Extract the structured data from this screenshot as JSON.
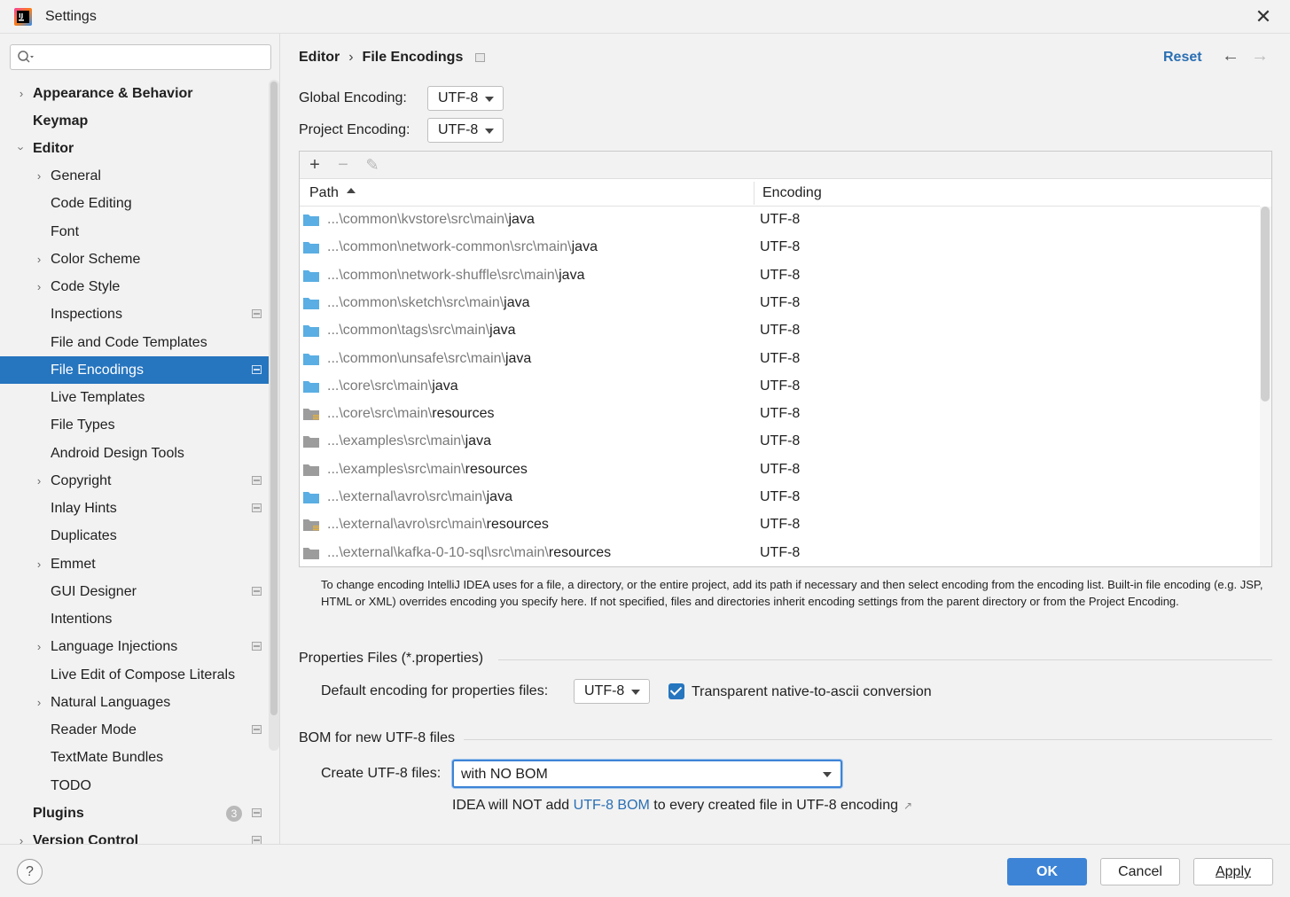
{
  "window": {
    "title": "Settings"
  },
  "search": {
    "placeholder": ""
  },
  "sidebar": {
    "items": [
      {
        "label": "Appearance & Behavior"
      },
      {
        "label": "Keymap"
      },
      {
        "label": "Editor"
      },
      {
        "label": "General"
      },
      {
        "label": "Code Editing"
      },
      {
        "label": "Font"
      },
      {
        "label": "Color Scheme"
      },
      {
        "label": "Code Style"
      },
      {
        "label": "Inspections"
      },
      {
        "label": "File and Code Templates"
      },
      {
        "label": "File Encodings"
      },
      {
        "label": "Live Templates"
      },
      {
        "label": "File Types"
      },
      {
        "label": "Android Design Tools"
      },
      {
        "label": "Copyright"
      },
      {
        "label": "Inlay Hints"
      },
      {
        "label": "Duplicates"
      },
      {
        "label": "Emmet"
      },
      {
        "label": "GUI Designer"
      },
      {
        "label": "Intentions"
      },
      {
        "label": "Language Injections"
      },
      {
        "label": "Live Edit of Compose Literals"
      },
      {
        "label": "Natural Languages"
      },
      {
        "label": "Reader Mode"
      },
      {
        "label": "TextMate Bundles"
      },
      {
        "label": "TODO"
      },
      {
        "label": "Plugins",
        "badge": "3"
      },
      {
        "label": "Version Control"
      }
    ]
  },
  "header": {
    "breadcrumb_parent": "Editor",
    "breadcrumb_sep": "›",
    "breadcrumb_current": "File Encodings",
    "reset_label": "Reset",
    "back_icon": "←",
    "forward_icon": "→"
  },
  "encoding": {
    "global_label": "Global Encoding:",
    "global_value": "UTF-8",
    "project_label": "Project Encoding:",
    "project_value": "UTF-8"
  },
  "table": {
    "toolbar": {
      "add": "+",
      "remove": "−",
      "edit": "✎"
    },
    "columns": {
      "path": "Path",
      "encoding": "Encoding"
    },
    "rows": [
      {
        "dim": "...\\common\\kvstore\\src\\main\\",
        "leaf": "java",
        "encoding": "UTF-8",
        "folder": "blue"
      },
      {
        "dim": "...\\common\\network-common\\src\\main\\",
        "leaf": "java",
        "encoding": "UTF-8",
        "folder": "blue"
      },
      {
        "dim": "...\\common\\network-shuffle\\src\\main\\",
        "leaf": "java",
        "encoding": "UTF-8",
        "folder": "blue"
      },
      {
        "dim": "...\\common\\sketch\\src\\main\\",
        "leaf": "java",
        "encoding": "UTF-8",
        "folder": "blue"
      },
      {
        "dim": "...\\common\\tags\\src\\main\\",
        "leaf": "java",
        "encoding": "UTF-8",
        "folder": "blue"
      },
      {
        "dim": "...\\common\\unsafe\\src\\main\\",
        "leaf": "java",
        "encoding": "UTF-8",
        "folder": "blue"
      },
      {
        "dim": "...\\core\\src\\main\\",
        "leaf": "java",
        "encoding": "UTF-8",
        "folder": "blue"
      },
      {
        "dim": "...\\core\\src\\main\\",
        "leaf": "resources",
        "encoding": "UTF-8",
        "folder": "resources"
      },
      {
        "dim": "...\\examples\\src\\main\\",
        "leaf": "java",
        "encoding": "UTF-8",
        "folder": "gray"
      },
      {
        "dim": "...\\examples\\src\\main\\",
        "leaf": "resources",
        "encoding": "UTF-8",
        "folder": "gray"
      },
      {
        "dim": "...\\external\\avro\\src\\main\\",
        "leaf": "java",
        "encoding": "UTF-8",
        "folder": "blue"
      },
      {
        "dim": "...\\external\\avro\\src\\main\\",
        "leaf": "resources",
        "encoding": "UTF-8",
        "folder": "resources"
      },
      {
        "dim": "...\\external\\kafka-0-10-sql\\src\\main\\",
        "leaf": "resources",
        "encoding": "UTF-8",
        "folder": "gray"
      }
    ]
  },
  "help_text": "To change encoding IntelliJ IDEA uses for a file, a directory, or the entire project, add its path if necessary and then select encoding from the encoding list. Built-in file encoding (e.g. JSP, HTML or XML) overrides encoding you specify here. If not specified, files and directories inherit encoding settings from the parent directory or from the Project Encoding.",
  "properties": {
    "section_title": "Properties Files (*.properties)",
    "default_label": "Default encoding for properties files:",
    "default_value": "UTF-8",
    "transparent_label": "Transparent native-to-ascii conversion",
    "transparent_checked": true
  },
  "bom": {
    "section_title": "BOM for new UTF-8 files",
    "create_label": "Create UTF-8 files:",
    "create_value": "with NO BOM",
    "hint_prefix": "IDEA will NOT add ",
    "hint_link": "UTF-8 BOM",
    "hint_suffix": " to every created file in UTF-8 encoding",
    "hint_ext": "↗"
  },
  "footer": {
    "help": "?",
    "ok": "OK",
    "cancel": "Cancel",
    "apply": "Apply"
  },
  "colors": {
    "accent": "#2675bf",
    "link": "#2a6fb3",
    "folder_blue": "#5aaee3",
    "folder_gray": "#9c9c9c"
  }
}
